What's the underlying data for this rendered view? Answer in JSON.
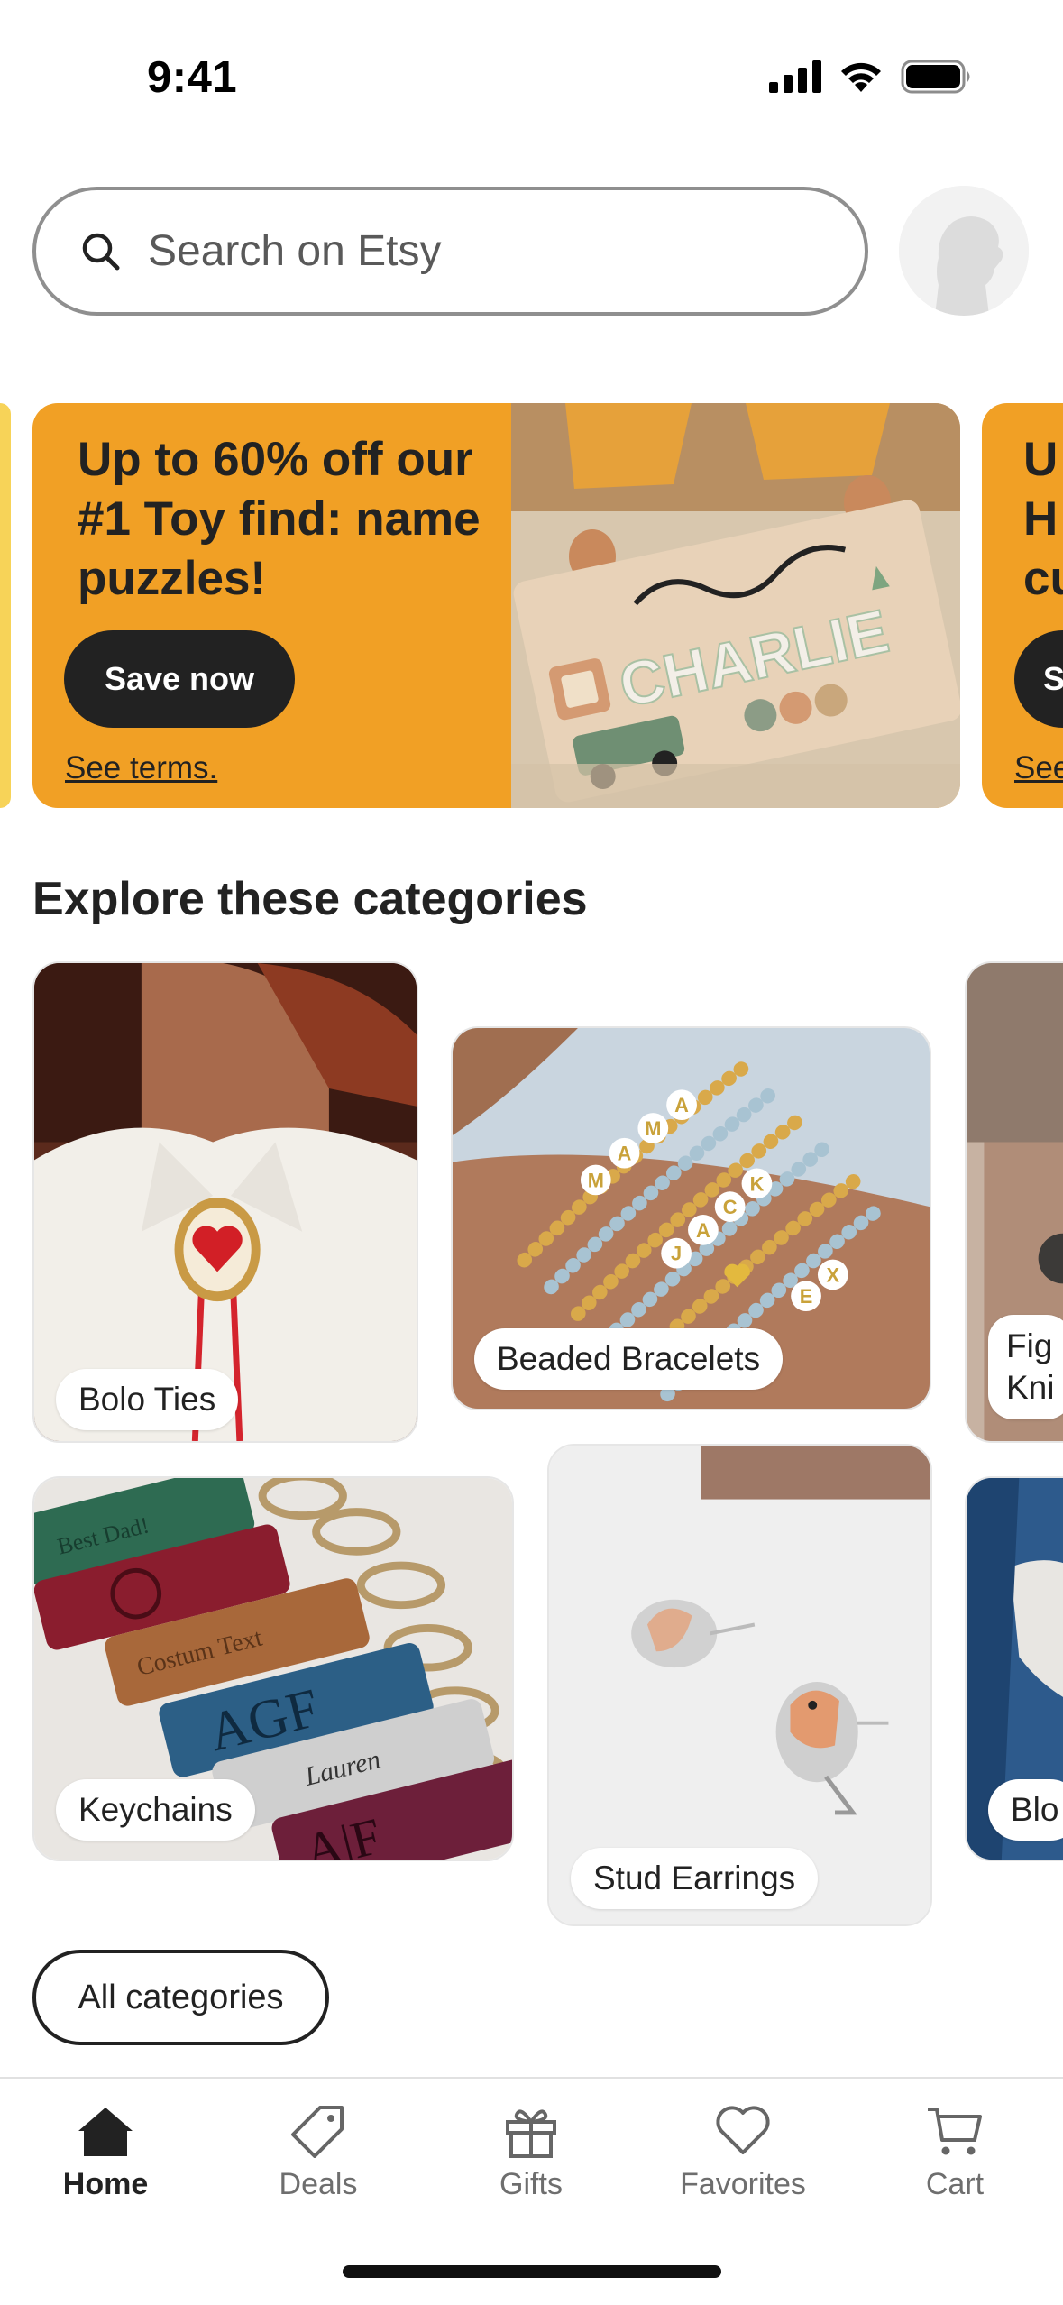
{
  "status_bar": {
    "time": "9:41"
  },
  "search": {
    "placeholder": "Search on Etsy"
  },
  "promo": {
    "headline": "Up to 60% off our #1 Toy find: name puzzles!",
    "cta": "Save now",
    "terms": "See terms.",
    "puzzle_name": "CHARLIE",
    "next_card_peek": {
      "headline_lines": [
        "U",
        "H",
        "cu"
      ],
      "cta": "S",
      "terms": "See"
    }
  },
  "categories": {
    "title": "Explore these categories",
    "items": [
      {
        "label": "Bolo Ties"
      },
      {
        "label": "Beaded Bracelets"
      },
      {
        "label_lines": [
          "Fig",
          "Kni"
        ]
      },
      {
        "label": "Keychains"
      },
      {
        "label": "Stud Earrings"
      },
      {
        "label": "Blo"
      }
    ],
    "image_text": {
      "bracelet_letters": [
        "M",
        "A",
        "M",
        "A",
        "J",
        "A",
        "C",
        "K",
        "E",
        "X"
      ],
      "keychain_texts": [
        "Best Dad!",
        "Costum Text",
        "AGF",
        "Lauren",
        "A|F"
      ]
    },
    "all_label": "All categories"
  },
  "tabs": [
    {
      "label": "Home",
      "icon": "home-icon",
      "active": true
    },
    {
      "label": "Deals",
      "icon": "tag-icon",
      "active": false
    },
    {
      "label": "Gifts",
      "icon": "gift-icon",
      "active": false
    },
    {
      "label": "Favorites",
      "icon": "heart-icon",
      "active": false
    },
    {
      "label": "Cart",
      "icon": "cart-icon",
      "active": false
    }
  ],
  "colors": {
    "promo_background": "#f1a025",
    "button_dark": "#222222",
    "text": "#222222",
    "tab_inactive": "#6e6e6e"
  }
}
